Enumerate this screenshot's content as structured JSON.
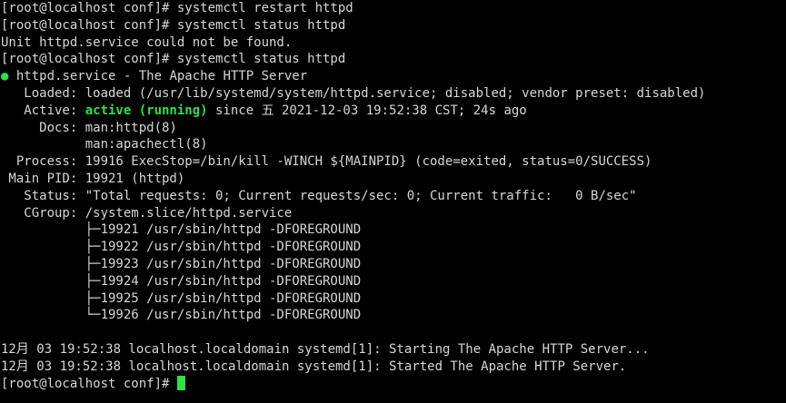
{
  "lines": {
    "l0": "[root@localhost conf]# systemctl restart httpd",
    "l1": "[root@localhost conf]# systemctl status httpd",
    "l2": "Unit httpd.service could not be found.",
    "l3": "[root@localhost conf]# systemctl status httpd",
    "l4_dot": "●",
    "l4_rest": " httpd.service - The Apache HTTP Server",
    "l5": "   Loaded: loaded (/usr/lib/systemd/system/httpd.service; disabled; vendor preset: disabled)",
    "l6_prefix": "   Active: ",
    "l6_status": "active (running)",
    "l6_suffix": " since 五 2021-12-03 19:52:38 CST; 24s ago",
    "l7": "     Docs: man:httpd(8)",
    "l8": "           man:apachectl(8)",
    "l9": "  Process: 19916 ExecStop=/bin/kill -WINCH ${MAINPID} (code=exited, status=0/SUCCESS)",
    "l10": " Main PID: 19921 (httpd)",
    "l11": "   Status: \"Total requests: 0; Current requests/sec: 0; Current traffic:   0 B/sec\"",
    "l12": "   CGroup: /system.slice/httpd.service",
    "l13": "           ├─19921 /usr/sbin/httpd -DFOREGROUND",
    "l14": "           ├─19922 /usr/sbin/httpd -DFOREGROUND",
    "l15": "           ├─19923 /usr/sbin/httpd -DFOREGROUND",
    "l16": "           ├─19924 /usr/sbin/httpd -DFOREGROUND",
    "l17": "           ├─19925 /usr/sbin/httpd -DFOREGROUND",
    "l18": "           └─19926 /usr/sbin/httpd -DFOREGROUND",
    "l19": "",
    "l20": "12月 03 19:52:38 localhost.localdomain systemd[1]: Starting The Apache HTTP Server...",
    "l21": "12月 03 19:52:38 localhost.localdomain systemd[1]: Started The Apache HTTP Server.",
    "l22": "[root@localhost conf]# "
  },
  "colors": {
    "background": "#000000",
    "text": "#d6d6d6",
    "accent_green": "#2ee04a"
  }
}
